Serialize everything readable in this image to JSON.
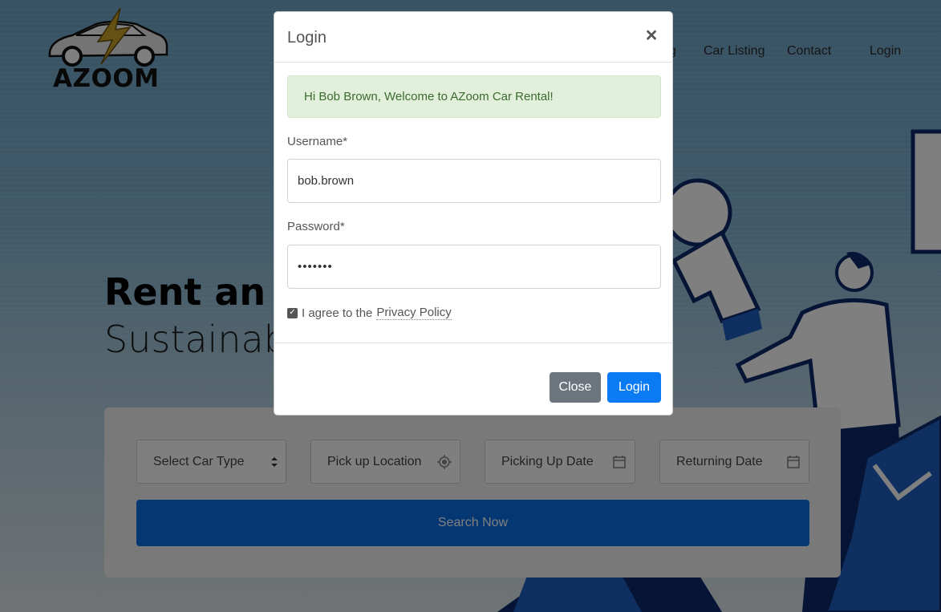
{
  "brand": {
    "name": "AZOOM"
  },
  "nav": {
    "items": [
      "g",
      "Car Listing",
      "Contact",
      "Login"
    ]
  },
  "hero": {
    "title": "Rent an E",
    "subtitle": "Sustainabl"
  },
  "search": {
    "car_type": "Select Car Type",
    "pickup_location": "Pick up Location",
    "pickup_date": "Picking Up Date",
    "return_date": "Returning Date",
    "button": "Search Now"
  },
  "modal": {
    "title": "Login",
    "close_glyph": "×",
    "alert": "Hi Bob Brown, Welcome to AZoom Car Rental!",
    "username_label": "Username*",
    "username_value": "bob.brown",
    "password_label": "Password*",
    "password_value": "•••••••",
    "agree_text": "I agree to the",
    "privacy_link": "Privacy Policy",
    "checkbox_checked": true,
    "close_button": "Close",
    "login_button": "Login"
  },
  "colors": {
    "primary": "#0a7bf3",
    "secondary": "#6c757d",
    "alert_bg": "#e2efdb",
    "alert_text": "#3b6b2f"
  }
}
